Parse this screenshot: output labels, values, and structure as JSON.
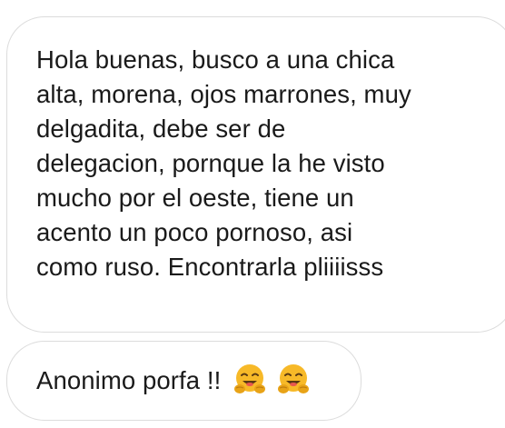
{
  "messages": [
    {
      "lines": [
        "Hola buenas, busco a una chica",
        "alta, morena, ojos marrones, muy",
        "delgadita, debe ser de",
        "delegacion, pornque la he visto",
        "mucho por el oeste, tiene un",
        "acento un poco pornoso, asi",
        "como ruso. Encontrarla pliiiisss"
      ]
    },
    {
      "text": "Anonimo porfa !!",
      "emojis": [
        "hugging-face-icon",
        "hugging-face-icon"
      ]
    }
  ],
  "colors": {
    "bubble_border": "#dcdcdc",
    "text": "#1a1a1a",
    "emoji_face": "#f7b928",
    "emoji_face_shade": "#e8a317"
  }
}
